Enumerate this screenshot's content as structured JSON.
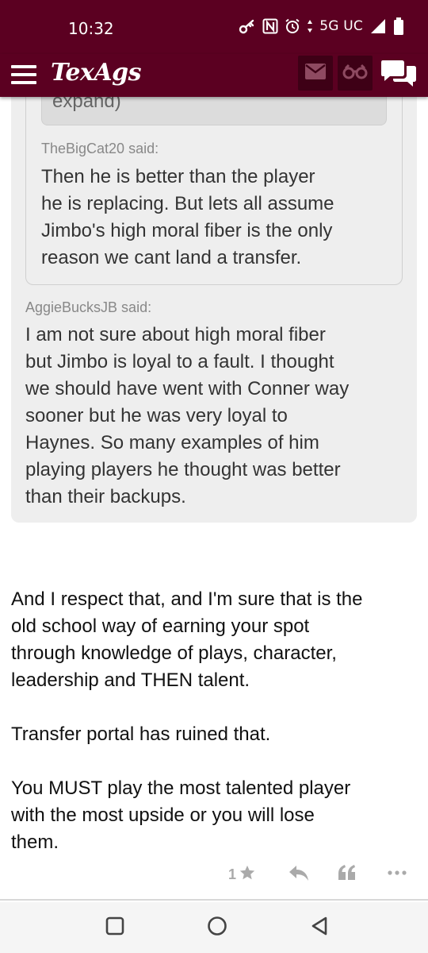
{
  "status_bar": {
    "time": "10:32",
    "network": "5G UC",
    "icons": [
      "key-icon",
      "nfc-icon",
      "alarm-icon",
      "data-arrows-icon",
      "signal-icon",
      "battery-icon"
    ]
  },
  "header": {
    "logo": "TexAgs",
    "icons": [
      "menu-icon",
      "mail-icon",
      "binoculars-icon",
      "chat-bubbles-icon"
    ],
    "colors": {
      "brand": "#5b0021",
      "button_bg": "#3e0016"
    }
  },
  "quotes": {
    "nested_fragment": "expand)",
    "inner": {
      "author_said": "TheBigCat20 said:",
      "text": "Then he is better than the player\nhe is replacing. But lets all assume\nJimbo's high moral fiber is the only\nreason we cant land a transfer."
    },
    "outer": {
      "author_said": "AggieBucksJB said:",
      "text": "I am not sure about high moral fiber\nbut Jimbo is loyal to a fault. I thought\nwe should have went with Conner way\nsooner but he was very loyal to\nHaynes. So many examples of him\nplaying players he thought was better\nthan their backups."
    }
  },
  "post": {
    "paragraphs": [
      "And I respect that, and I'm sure that is the\nold school way of earning your spot\nthrough knowledge of plays, character,\nleadership and THEN talent.",
      "Transfer portal has ruined that.",
      "You MUST play the most talented player\nwith the most upside or you will lose\nthem."
    ]
  },
  "actions": {
    "star_count": "1",
    "icons": [
      "star-icon",
      "reply-icon",
      "quote-icon",
      "more-icon"
    ]
  },
  "nav_bar": {
    "icons": [
      "recents-square-icon",
      "home-circle-icon",
      "back-triangle-icon"
    ]
  }
}
